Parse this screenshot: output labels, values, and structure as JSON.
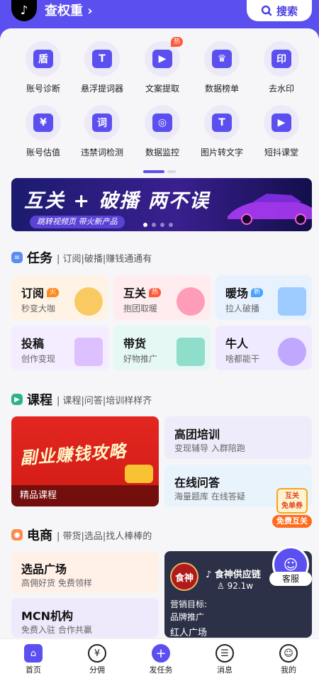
{
  "header": {
    "app_name": "查权重",
    "title_arrow": "›",
    "search_label": "搜索",
    "app_icon": "music-note-icon"
  },
  "tools": [
    {
      "label": "账号诊断",
      "icon": "shield-check-icon",
      "glyph": "盾"
    },
    {
      "label": "悬浮提词器",
      "icon": "prompter-icon",
      "glyph": "T"
    },
    {
      "label": "文案提取",
      "icon": "video-extract-icon",
      "glyph": "▶",
      "badge": "热"
    },
    {
      "label": "数据榜单",
      "icon": "crown-icon",
      "glyph": "♛"
    },
    {
      "label": "去水印",
      "icon": "stamp-icon",
      "glyph": "印"
    },
    {
      "label": "账号估值",
      "icon": "user-value-icon",
      "glyph": "¥"
    },
    {
      "label": "违禁词检测",
      "icon": "word-check-icon",
      "glyph": "词"
    },
    {
      "label": "数据监控",
      "icon": "monitor-icon",
      "glyph": "◎"
    },
    {
      "label": "图片转文字",
      "icon": "image-text-icon",
      "glyph": "T"
    },
    {
      "label": "短抖课堂",
      "icon": "classroom-icon",
      "glyph": "▶"
    }
  ],
  "banner": {
    "title": "互关 + 破播  两不误",
    "subtitle": "跳转视频页 带火新产品"
  },
  "tasks": {
    "title": "任务",
    "subtitle": "| 订阅|破播|赚钱通通有",
    "cards": [
      {
        "title": "订阅",
        "badge": "火",
        "desc": "秒变大咖"
      },
      {
        "title": "互关",
        "badge": "热",
        "desc": "抱团取暖"
      },
      {
        "title": "暖场",
        "badge": "新",
        "desc": "拉人破播"
      },
      {
        "title": "投稿",
        "desc": "创作变现"
      },
      {
        "title": "带货",
        "desc": "好物推广"
      },
      {
        "title": "牛人",
        "desc": "啥都能干"
      }
    ]
  },
  "courses": {
    "title": "课程",
    "subtitle": "| 课程|问答|培训样样齐",
    "big_title": "副业赚钱攻略",
    "big_footer": "精品课程",
    "cards": [
      {
        "title": "高团培训",
        "desc": "变现辅导 入群陪跑"
      },
      {
        "title": "在线问答",
        "desc": "海量题库 在线答疑"
      }
    ],
    "coupon_top": "互关\n免单券",
    "coupon_label": "免费互关"
  },
  "ecommerce": {
    "title": "电商",
    "subtitle": "| 带货|选品|找人棒棒的",
    "cards": [
      {
        "title": "选品广场",
        "desc": "高佣好货 免费领样"
      },
      {
        "title": "MCN机构",
        "desc": "免费入驻 合作共赢"
      }
    ],
    "kol": {
      "logo": "食神",
      "name": "食神供应链",
      "fans": "92.1w",
      "goal_label": "营销目标:",
      "goal_value": "品牌推广",
      "footer": "红人广场"
    }
  },
  "customer_service": {
    "label": "客服"
  },
  "tabbar": [
    {
      "label": "首页",
      "icon": "home-icon",
      "glyph": "⌂"
    },
    {
      "label": "分佣",
      "icon": "yen-icon",
      "glyph": "¥"
    },
    {
      "label": "发任务",
      "icon": "plus-icon",
      "glyph": "+"
    },
    {
      "label": "消息",
      "icon": "message-icon",
      "glyph": "☰"
    },
    {
      "label": "我的",
      "icon": "profile-icon",
      "glyph": "☺"
    }
  ],
  "colors": {
    "brand": "#5b4ff0",
    "hot": "#ff5a3a",
    "new": "#4aa3ff"
  }
}
